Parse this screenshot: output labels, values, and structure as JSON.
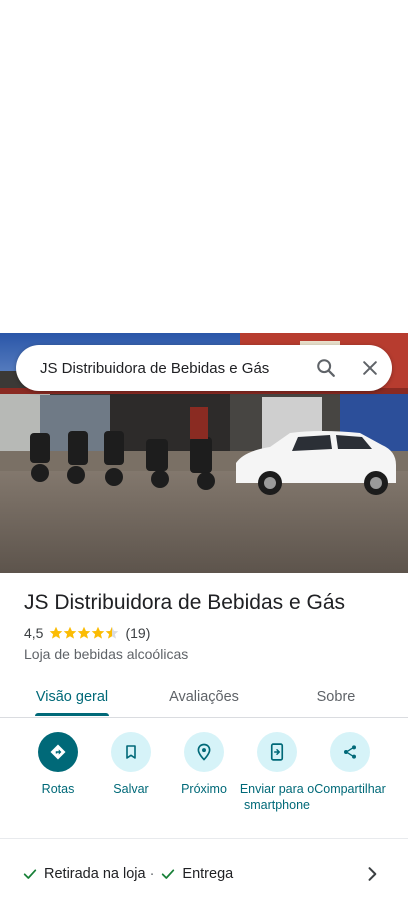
{
  "search": {
    "query": "JS Distribuidora de Bebidas e Gás"
  },
  "place": {
    "name": "JS Distribuidora de Bebidas e Gás",
    "rating": "4,5",
    "stars": 4.5,
    "reviews_count": "(19)",
    "category": "Loja de bebidas alcoólicas"
  },
  "tabs": [
    {
      "label": "Visão geral",
      "active": true
    },
    {
      "label": "Avaliações",
      "active": false
    },
    {
      "label": "Sobre",
      "active": false
    }
  ],
  "actions": [
    {
      "label": "Rotas",
      "icon": "directions-icon"
    },
    {
      "label": "Salvar",
      "icon": "bookmark-icon"
    },
    {
      "label": "Próximo",
      "icon": "nearby-icon"
    },
    {
      "label": "Enviar para o smartphone",
      "icon": "send-to-phone-icon"
    },
    {
      "label": "Compartilhar",
      "icon": "share-icon"
    }
  ],
  "services": {
    "pickup": "Retirada na loja",
    "separator": "·",
    "delivery": "Entrega"
  },
  "colors": {
    "accent": "#006978",
    "accent_light": "#d6f3f8",
    "star": "#fbbc04",
    "check": "#188038"
  }
}
